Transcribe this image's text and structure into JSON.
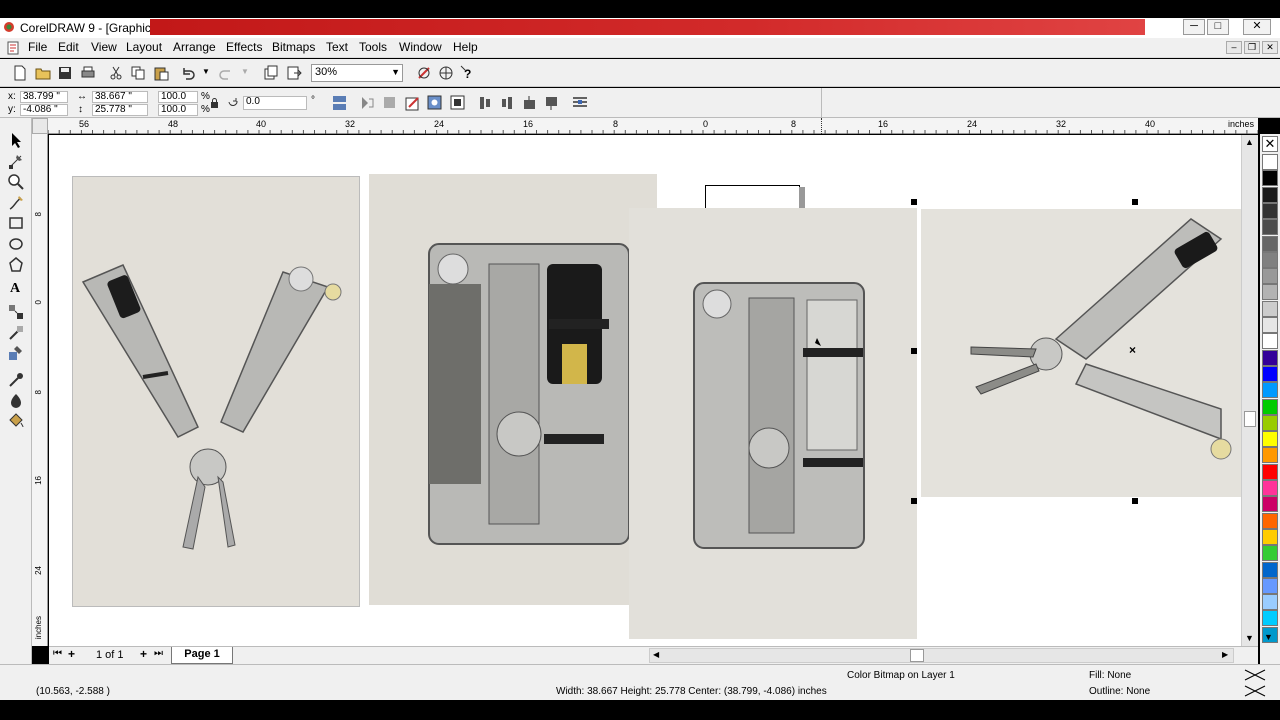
{
  "window": {
    "title": "CorelDRAW 9 - [Graphic1]",
    "controls": {
      "minimize": "─",
      "maximize": "□",
      "close": "✕"
    }
  },
  "menu": {
    "items": [
      "File",
      "Edit",
      "View",
      "Layout",
      "Arrange",
      "Effects",
      "Bitmaps",
      "Text",
      "Tools",
      "Window",
      "Help"
    ],
    "doc_controls": {
      "minimize": "–",
      "restore": "❐",
      "close": "✕"
    }
  },
  "toolbar": {
    "zoom_value": "30%",
    "icons": [
      "new-icon",
      "open-icon",
      "save-icon",
      "print-icon",
      "cut-icon",
      "copy-icon",
      "paste-icon",
      "undo-icon",
      "redo-icon",
      "import-icon",
      "export-icon",
      "zoom-dropdown",
      "application-launcher-icon",
      "corel-online-icon",
      "whats-this-icon"
    ]
  },
  "property_bar": {
    "x": "38.799 \"",
    "y": "-4.086 \"",
    "width": "38.667 \"",
    "height": "25.778 \"",
    "scale_x": "100.0",
    "scale_y": "100.0",
    "scale_unit": "%",
    "rotation": "0.0",
    "rotation_unit": "°"
  },
  "ruler": {
    "horizontal_ticks": [
      "56",
      "48",
      "40",
      "32",
      "24",
      "16",
      "8",
      "0",
      "8",
      "16",
      "24",
      "32",
      "40"
    ],
    "unit": "inches",
    "vertical_ticks": [
      "8",
      "0",
      "8",
      "16",
      "24"
    ],
    "vertical_unit": "inches"
  },
  "page_nav": {
    "counter": "1 of 1",
    "tab": "Page 1",
    "first": "⏮",
    "add_before": "+",
    "add_after": "+",
    "last": "⏭"
  },
  "status": {
    "cursor_position": "(10.563, -2.588 )",
    "selection_dims": "Width: 38.667  Height: 25.778  Center: (38.799, -4.086)  inches",
    "object_info": "Color Bitmap on Layer 1",
    "fill": "Fill: None",
    "outline": "Outline: None"
  },
  "palette_colors": [
    "#ffffff",
    "#000000",
    "#1a1a1a",
    "#333333",
    "#4d4d4d",
    "#666666",
    "#808080",
    "#999999",
    "#b3b3b3",
    "#cccccc",
    "#e6e6e6",
    "#ffffff",
    "#330099",
    "#0000ff",
    "#0099ff",
    "#00cc00",
    "#99cc00",
    "#ffff00",
    "#ff9900",
    "#ff0000",
    "#ff3399",
    "#cc0066",
    "#ff6600",
    "#ffcc00",
    "#33cc33",
    "#0066cc",
    "#6699ff",
    "#99ccff",
    "#00ccff",
    "#0099cc"
  ]
}
